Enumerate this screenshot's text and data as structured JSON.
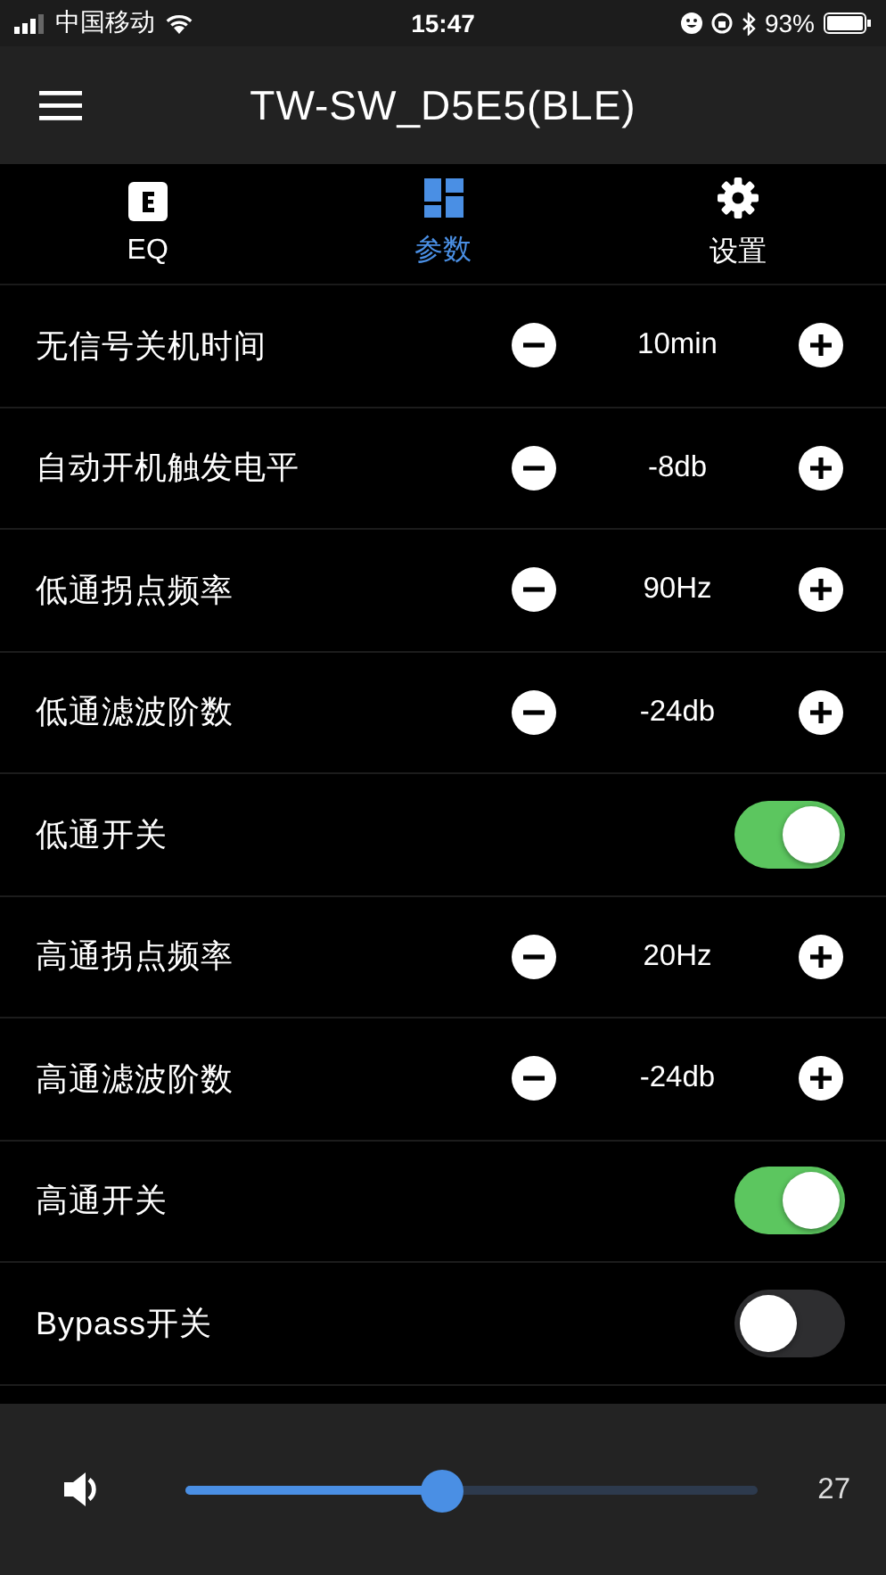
{
  "status_bar": {
    "carrier": "中国移动",
    "time": "15:47",
    "battery": "93%"
  },
  "header": {
    "title": "TW-SW_D5E5(BLE)"
  },
  "tabs": [
    {
      "label": "EQ",
      "selected": false
    },
    {
      "label": "参数",
      "selected": true
    },
    {
      "label": "设置",
      "selected": false
    }
  ],
  "params": [
    {
      "kind": "stepper",
      "label": "无信号关机时间",
      "value": "10min"
    },
    {
      "kind": "stepper",
      "label": "自动开机触发电平",
      "value": "-8db"
    },
    {
      "kind": "stepper",
      "label": "低通拐点频率",
      "value": "90Hz"
    },
    {
      "kind": "stepper",
      "label": "低通滤波阶数",
      "value": "-24db"
    },
    {
      "kind": "switch",
      "label": "低通开关",
      "on": true
    },
    {
      "kind": "stepper",
      "label": "高通拐点频率",
      "value": "20Hz"
    },
    {
      "kind": "stepper",
      "label": "高通滤波阶数",
      "value": "-24db"
    },
    {
      "kind": "switch",
      "label": "高通开关",
      "on": true
    },
    {
      "kind": "switch",
      "label": "Bypass开关",
      "on": false
    }
  ],
  "volume": {
    "level": 0.45,
    "reading": "27"
  }
}
